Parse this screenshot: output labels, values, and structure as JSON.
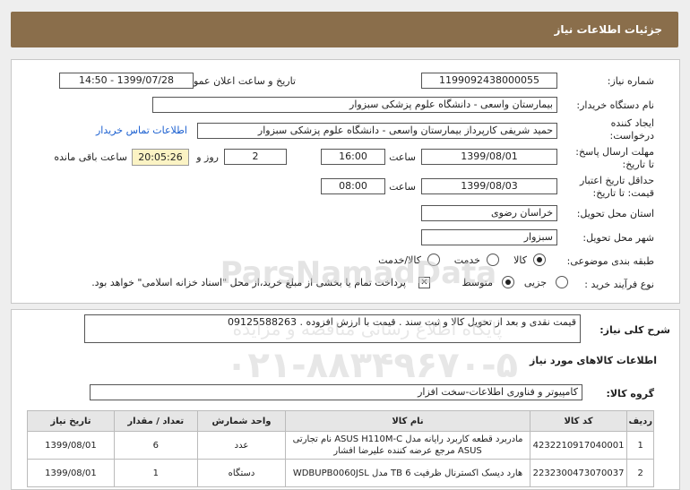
{
  "header": {
    "title": "جزئیات اطلاعات نیاز"
  },
  "form": {
    "need_number_label": "شماره نیاز:",
    "need_number": "1199092438000055",
    "announce_label": "تاریخ و ساعت اعلان عمومی:",
    "announce_value": "1399/07/28 - 14:50",
    "buyer_org_label": "نام دستگاه خریدار:",
    "buyer_org": "بیمارستان واسعی - دانشگاه علوم پزشکی سبزوار",
    "creator_label_1": "ایجاد کننده",
    "creator_label_2": "درخواست:",
    "creator": "حمید شریفی کارپرداز بیمارستان واسعی - دانشگاه علوم پزشکی سبزوار",
    "contact_link": "اطلاعات تماس خریدار",
    "deadline_label_1": "مهلت ارسال پاسخ:",
    "deadline_label_2": "تا تاریخ:",
    "deadline_date": "1399/08/01",
    "time_label": "ساعت",
    "deadline_time": "16:00",
    "days_value": "2",
    "days_label": "روز و",
    "remaining_timer": "20:05:26",
    "remaining_label": "ساعت باقی مانده",
    "validity_label_1": "حداقل تاریخ اعتبار",
    "validity_label_2": "قیمت: تا تاریخ:",
    "validity_date": "1399/08/03",
    "validity_time": "08:00",
    "province_label": "استان محل تحویل:",
    "province": "خراسان رضوی",
    "city_label": "شهر محل تحویل:",
    "city": "سبزوار",
    "category_label": "طبقه بندی موضوعی:",
    "category_options": [
      "کالا",
      "خدمت",
      "کالا/خدمت"
    ],
    "purchase_type_label": "نوع فرآیند خرید :",
    "purchase_options": [
      "جزیی",
      "متوسط"
    ],
    "payment_note": "پرداخت تمام یا بخشی از مبلغ خرید،از محل \"اسناد خزانه اسلامی\" خواهد بود."
  },
  "watermark": {
    "brand": "ParsNamadData",
    "line2": "پایگاه اطلاع رسانی مناقصه و مزایده",
    "phone": "۰۲۱-۸۸۳۴۹۶۷۰-۵"
  },
  "description": {
    "label": "شرح کلی نیاز:",
    "text": "قیمت نقدی و بعد از تحویل کالا و ثبت سند . قیمت با ارزش افزوده . 09125588263"
  },
  "goods": {
    "section_title": "اطلاعات کالاهای مورد نیاز",
    "group_label": "گروه کالا:",
    "group_value": "کامپیوتر و فناوری اطلاعات-سخت افزار",
    "columns": [
      "ردیف",
      "کد کالا",
      "نام کالا",
      "واحد شمارش",
      "تعداد / مقدار",
      "تاریخ نیاز"
    ],
    "rows": [
      {
        "index": "1",
        "code": "4232210917040001",
        "name": "مادربرد قطعه کاربرد رایانه مدل ASUS H110M-C نام تجارتی ASUS مرجع عرضه کننده علیرضا افشار",
        "unit": "عدد",
        "qty": "6",
        "date": "1399/08/01"
      },
      {
        "index": "2",
        "code": "2232300473070037",
        "name": "هارد دیسک اکسترنال ظرفیت 6 TB مدل WDBUPB0060JSL",
        "unit": "دستگاه",
        "qty": "1",
        "date": "1399/08/01"
      }
    ]
  }
}
